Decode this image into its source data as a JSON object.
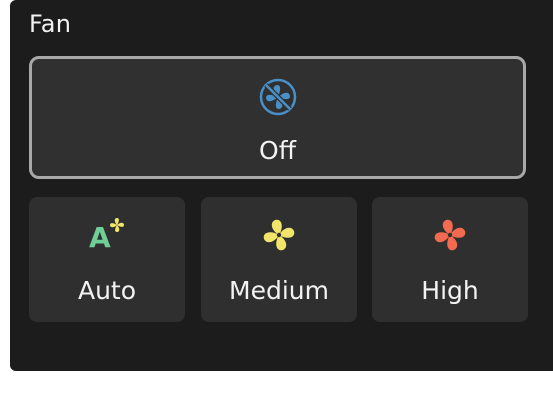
{
  "panel": {
    "title": "Fan"
  },
  "modes": {
    "off": {
      "label": "Off",
      "icon": "fan-off-icon",
      "color": "#4a90c8",
      "selected": true
    },
    "auto": {
      "label": "Auto",
      "icon": "fan-auto-icon",
      "color": "#6fcf97",
      "accent": "#f2e56b"
    },
    "medium": {
      "label": "Medium",
      "icon": "fan-icon",
      "color": "#f2e56b"
    },
    "high": {
      "label": "High",
      "icon": "fan-icon",
      "color": "#f26a4f"
    }
  }
}
